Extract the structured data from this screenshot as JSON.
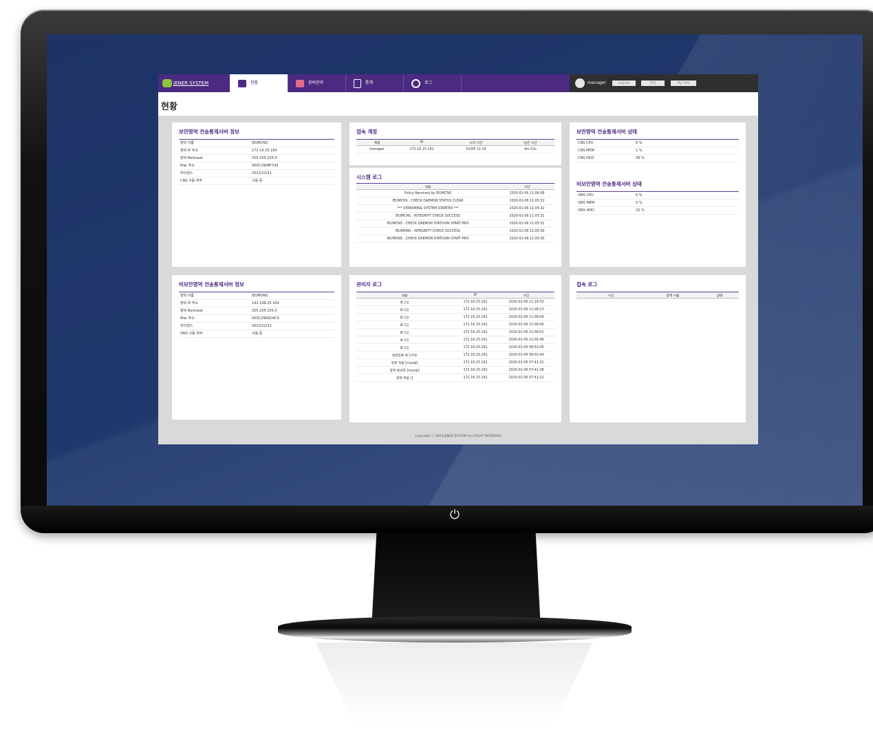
{
  "nav": {
    "logo": "JENER SYSTEM",
    "tabs": [
      {
        "label": "현황"
      },
      {
        "label": "장비관리"
      },
      {
        "label": "통계"
      },
      {
        "label": "로그"
      }
    ],
    "user": "manager",
    "buttons": {
      "logout": "Logout",
      "b2": "비번",
      "myinfo": "My Info"
    }
  },
  "page_title": "현황",
  "secure_info": {
    "title": "보안영역 전송통제서버 정보",
    "rows": [
      {
        "k": "장비 이름",
        "v": "IEUMCNS"
      },
      {
        "k": "장비 IP 주소",
        "v": "172.16.25.164"
      },
      {
        "k": "장비 Netmask",
        "v": "255.255.255.0"
      },
      {
        "k": "Mac 주소",
        "v": "000C290BF743"
      },
      {
        "k": "라이센스",
        "v": "2022/12/31"
      },
      {
        "k": "CNS 구동 여부",
        "v": "구동 중"
      }
    ]
  },
  "nonsecure_info": {
    "title": "비보안영역 전송통제서버 정보",
    "rows": [
      {
        "k": "장비 이름",
        "v": "IEUMONS"
      },
      {
        "k": "장비 IP 주소",
        "v": "192.168.25.164"
      },
      {
        "k": "장비 Netmask",
        "v": "255.255.255.0"
      },
      {
        "k": "Mac 주소",
        "v": "000C29EAD4C9"
      },
      {
        "k": "라이센스",
        "v": "2022/12/31"
      },
      {
        "k": "ONS 구동 여부",
        "v": "구동 중"
      }
    ]
  },
  "access_account": {
    "title": "접속 계정",
    "headers": [
      "계정",
      "IP",
      "시작 시간",
      "남은 시간"
    ],
    "row": [
      "manager",
      "172.16.25.161",
      "01/06 11:14",
      "9m 52s"
    ]
  },
  "system_log": {
    "title": "시스템 로그",
    "headers": [
      "내용",
      "시간"
    ],
    "rows": [
      [
        "Policy Received by IEUMCNS",
        "2020-01-06 11:06:08"
      ],
      [
        "IEUMCNS : CHECK DAEMON STATUS CLEAR",
        "2020-01-06 11:05:32"
      ],
      [
        "*** STREAMING SYSTEM STARTED ***",
        "2020-01-06 11:05:32"
      ],
      [
        "IEUMCNS : INTEGRITY CHECK SUCCESS",
        "2020-01-06 11:05:31"
      ],
      [
        "IEUMCNS : CHECK DAEMON STATUSIN START PRO",
        "2020-01-06 11:05:31"
      ],
      [
        "IEUMONS : INTEGRITY CHECK SUCCESS",
        "2020-01-06 11:05:30"
      ],
      [
        "IEUMONS : CHECK DAEMON STATUSIN START PRO",
        "2020-01-06 11:05:30"
      ]
    ]
  },
  "admin_log": {
    "title": "관리자 로그",
    "headers": [
      "내용",
      "IP",
      "시간"
    ],
    "rows": [
      [
        "로그인",
        "172.16.25.161",
        "2020-01-06 11:14:33"
      ],
      [
        "로그인",
        "172.16.25.161",
        "2020-01-06 11:06:13"
      ],
      [
        "로그인",
        "172.16.25.161",
        "2020-01-06 11:06:09"
      ],
      [
        "로그인",
        "172.16.25.161",
        "2020-01-06 11:06:06"
      ],
      [
        "로그인",
        "172.16.25.161",
        "2020-01-06 11:06:02"
      ],
      [
        "로그인",
        "172.16.25.161",
        "2020-01-06 11:05:49"
      ],
      [
        "로그인",
        "172.16.25.161",
        "2020-01-06 08:52:05"
      ],
      [
        "세션만료 로그아웃",
        "172.16.25.161",
        "2020-01-06 08:02:44"
      ],
      [
        "정책 적용 [mysql]",
        "172.16.25.161",
        "2020-01-06 07:41:32"
      ],
      [
        "정책 활성화 [mysql]",
        "172.16.25.161",
        "2020-01-06 07:41:28"
      ],
      [
        "정책 적용 []",
        "172.16.25.161",
        "2020-01-06 07:41:22"
      ]
    ]
  },
  "secure_status": {
    "title": "보안영역 전송통제서버 상태",
    "rows": [
      {
        "k": "CNS CPU",
        "v": "6 %"
      },
      {
        "k": "CNS MEM",
        "v": "1 %"
      },
      {
        "k": "CNS HDD",
        "v": "39 %"
      }
    ]
  },
  "nonsecure_status": {
    "title": "비보안영역 전송통제서버 상태",
    "rows": [
      {
        "k": "ONS CPU",
        "v": "6 %"
      },
      {
        "k": "ONS MEM",
        "v": "0 %"
      },
      {
        "k": "ONS HDD",
        "v": "22 %"
      }
    ]
  },
  "access_log": {
    "title": "접속 로그",
    "headers": [
      "시간",
      "정책 이름",
      "상태"
    ]
  },
  "footer": "Copyright ⓒ 2019 JENER SYSTEM ALL RIGHT RESERVED",
  "power_icon": "⏻",
  "colors": {
    "brand": "#4b2a82",
    "screen_bg": "#1d3366"
  }
}
